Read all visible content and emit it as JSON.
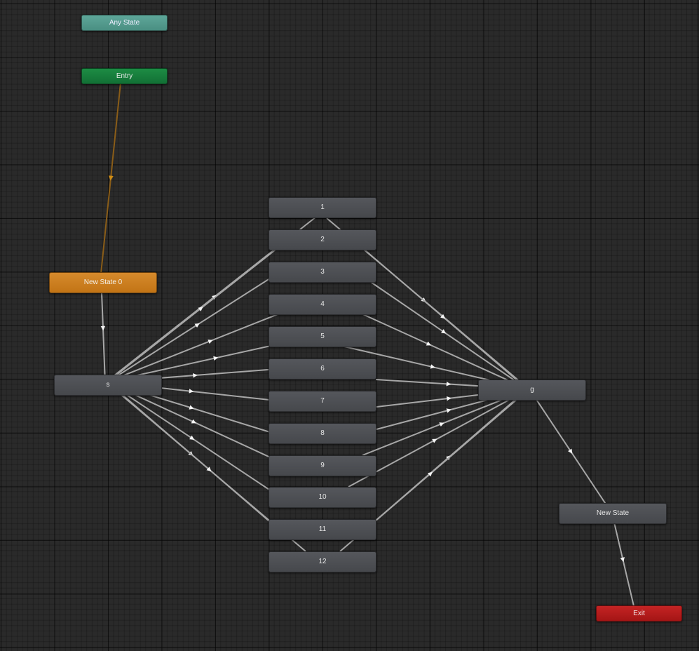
{
  "graph": {
    "colors": {
      "background": "#2a2a2a",
      "transition": "#a7a7a7",
      "entry_transition": "#8a5d18",
      "state": "#4c4e52",
      "any_state": "#55a091",
      "entry": "#188040",
      "default_state": "#cd7f20",
      "exit": "#b51c1c"
    },
    "nodes": {
      "any_state": "Any State",
      "entry": "Entry",
      "default_state": "New State 0",
      "s": "s",
      "g": "g",
      "new_state": "New State",
      "exit": "Exit",
      "middle": [
        "1",
        "2",
        "3",
        "4",
        "5",
        "6",
        "7",
        "8",
        "9",
        "10",
        "11",
        "12"
      ]
    },
    "transitions": [
      {
        "from": "Entry",
        "to": "New State 0"
      },
      {
        "from": "New State 0",
        "to": "s"
      },
      {
        "from": "s",
        "to": "1"
      },
      {
        "from": "s",
        "to": "2"
      },
      {
        "from": "s",
        "to": "3"
      },
      {
        "from": "s",
        "to": "4"
      },
      {
        "from": "s",
        "to": "5"
      },
      {
        "from": "s",
        "to": "6"
      },
      {
        "from": "s",
        "to": "7"
      },
      {
        "from": "s",
        "to": "8"
      },
      {
        "from": "s",
        "to": "9"
      },
      {
        "from": "s",
        "to": "10"
      },
      {
        "from": "s",
        "to": "11"
      },
      {
        "from": "s",
        "to": "12"
      },
      {
        "from": "1",
        "to": "g"
      },
      {
        "from": "2",
        "to": "g"
      },
      {
        "from": "3",
        "to": "g"
      },
      {
        "from": "4",
        "to": "g"
      },
      {
        "from": "5",
        "to": "g"
      },
      {
        "from": "6",
        "to": "g"
      },
      {
        "from": "7",
        "to": "g"
      },
      {
        "from": "8",
        "to": "g"
      },
      {
        "from": "9",
        "to": "g"
      },
      {
        "from": "10",
        "to": "g"
      },
      {
        "from": "11",
        "to": "g"
      },
      {
        "from": "12",
        "to": "g"
      },
      {
        "from": "g",
        "to": "New State"
      },
      {
        "from": "New State",
        "to": "Exit"
      }
    ]
  }
}
